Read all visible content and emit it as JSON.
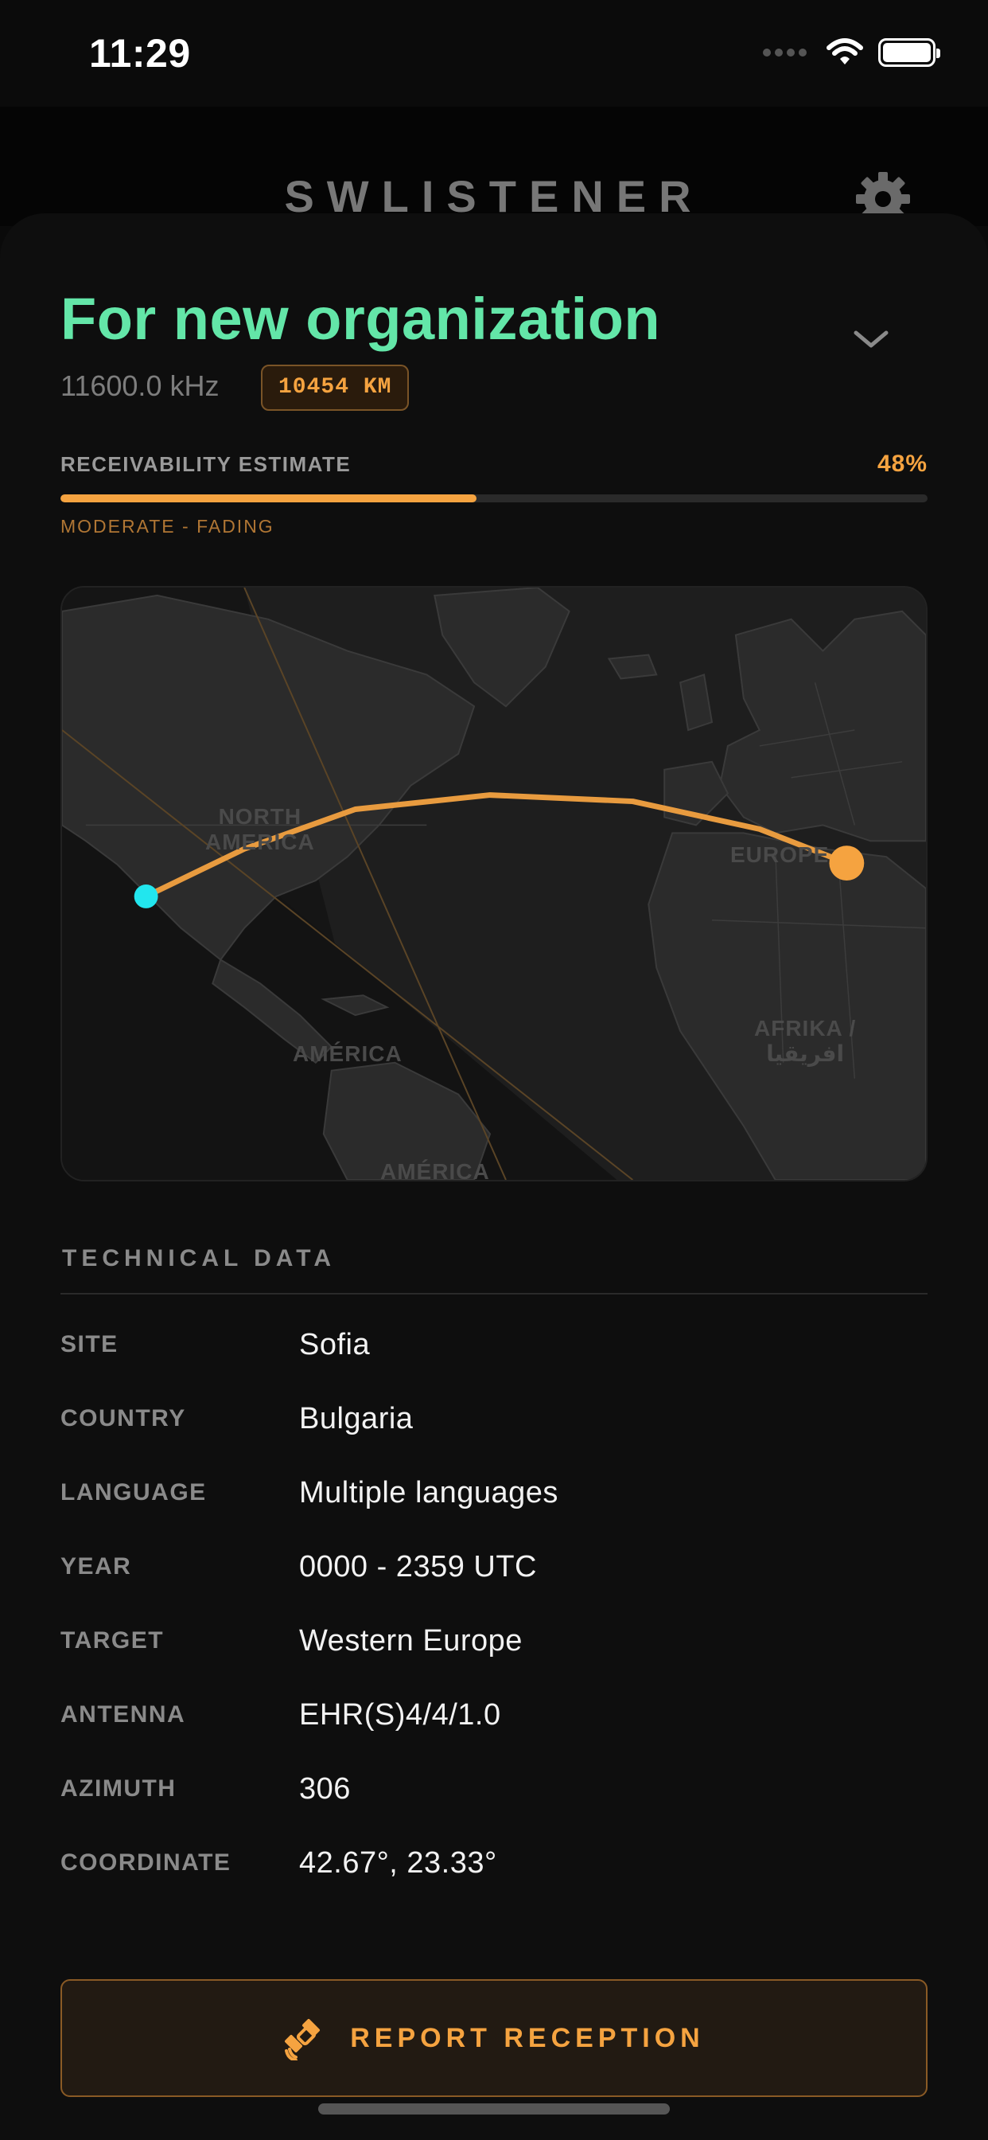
{
  "status_bar": {
    "time": "11:29"
  },
  "app": {
    "title": "SWLISTENER"
  },
  "station": {
    "name": "For new organization",
    "frequency": "11600.0 kHz",
    "distance": "10454 KM"
  },
  "receivability": {
    "label": "RECEIVABILITY ESTIMATE",
    "percent_text": "48%",
    "value": 0.48,
    "status": "MODERATE - FADING"
  },
  "map": {
    "labels": {
      "north_america": "NORTH\nAMERICA",
      "europe": "EUROPE",
      "africa": "AFRIKA /\nافريقيا",
      "central_america": "AMÉRICA",
      "south_america": "AMÉRICA"
    },
    "colors": {
      "path": "#e89b3f",
      "receiver": "#22e6ee",
      "transmitter": "#f5a340"
    }
  },
  "technical": {
    "header": "TECHNICAL DATA",
    "rows": [
      {
        "key": "SITE",
        "value": "Sofia"
      },
      {
        "key": "COUNTRY",
        "value": "Bulgaria"
      },
      {
        "key": "LANGUAGE",
        "value": "Multiple languages"
      },
      {
        "key": "YEAR",
        "value": "0000 - 2359 UTC"
      },
      {
        "key": "TARGET",
        "value": "Western Europe"
      },
      {
        "key": "ANTENNA",
        "value": "EHR(S)4/4/1.0"
      },
      {
        "key": "AZIMUTH",
        "value": "306"
      },
      {
        "key": "COORDINATE",
        "value": "42.67°, 23.33°"
      }
    ]
  },
  "actions": {
    "report_label": "REPORT RECEPTION"
  },
  "colors": {
    "accent_green": "#63e6a8",
    "accent_orange": "#f5a340"
  },
  "icons": {
    "settings": "gear-icon",
    "expand": "chevron-down-icon",
    "report": "satellite-icon",
    "wifi": "wifi-icon",
    "battery": "battery-icon"
  }
}
